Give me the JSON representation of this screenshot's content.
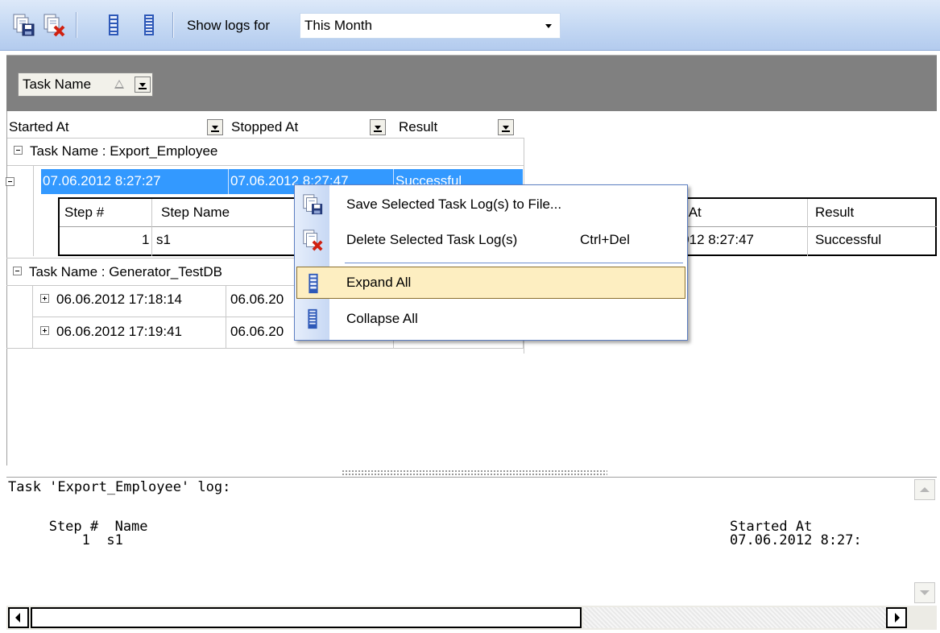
{
  "toolbar": {
    "show_logs_label": "Show logs for",
    "period_value": "This Month",
    "buttons": [
      "save-log-icon",
      "delete-log-icon",
      "expand-all-icon",
      "collapse-all-icon"
    ]
  },
  "group_panel": {
    "group_field": "Task Name"
  },
  "grid": {
    "columns": [
      "Started At",
      "Stopped At",
      "Result"
    ],
    "groups": [
      {
        "title": "Task Name : Export_Employee",
        "rows": [
          {
            "started": "07.06.2012 8:27:27",
            "stopped": "07.06.2012 8:27:47",
            "result": "Successful"
          }
        ]
      },
      {
        "title": "Task Name : Generator_TestDB",
        "rows": [
          {
            "started": "06.06.2012 17:18:14",
            "stopped": "06.06.20"
          },
          {
            "started": "06.06.2012 17:19:41",
            "stopped": "06.06.20"
          }
        ]
      }
    ],
    "detail": {
      "columns": [
        "Step #",
        "Step Name",
        "ed At",
        "Result"
      ],
      "row": {
        "step": "1",
        "name": "s1",
        "stopped": ".2012 8:27:47",
        "result": "Successful"
      }
    }
  },
  "context_menu": {
    "items": [
      {
        "label": "Save Selected Task Log(s) to File...",
        "shortcut": "",
        "icon": "save-log-icon"
      },
      {
        "label": "Delete Selected Task Log(s)",
        "shortcut": "Ctrl+Del",
        "icon": "delete-log-icon"
      },
      {
        "label": "Expand All",
        "shortcut": "",
        "icon": "expand-all-icon",
        "highlighted": true
      },
      {
        "label": "Collapse All",
        "shortcut": "",
        "icon": "collapse-all-icon"
      }
    ]
  },
  "log_memo": {
    "line1": "Task 'Export_Employee' log:",
    "line2": "   Step #  Name",
    "line2_right": "Started At",
    "line3": "       1  s1",
    "line3_right": "07.06.2012 8:27:"
  },
  "colors": {
    "toolbar_bg": "#c4d8f3",
    "selection": "#3399ff",
    "menu_highlight": "#fdeec1",
    "group_panel_bg": "#808080"
  }
}
